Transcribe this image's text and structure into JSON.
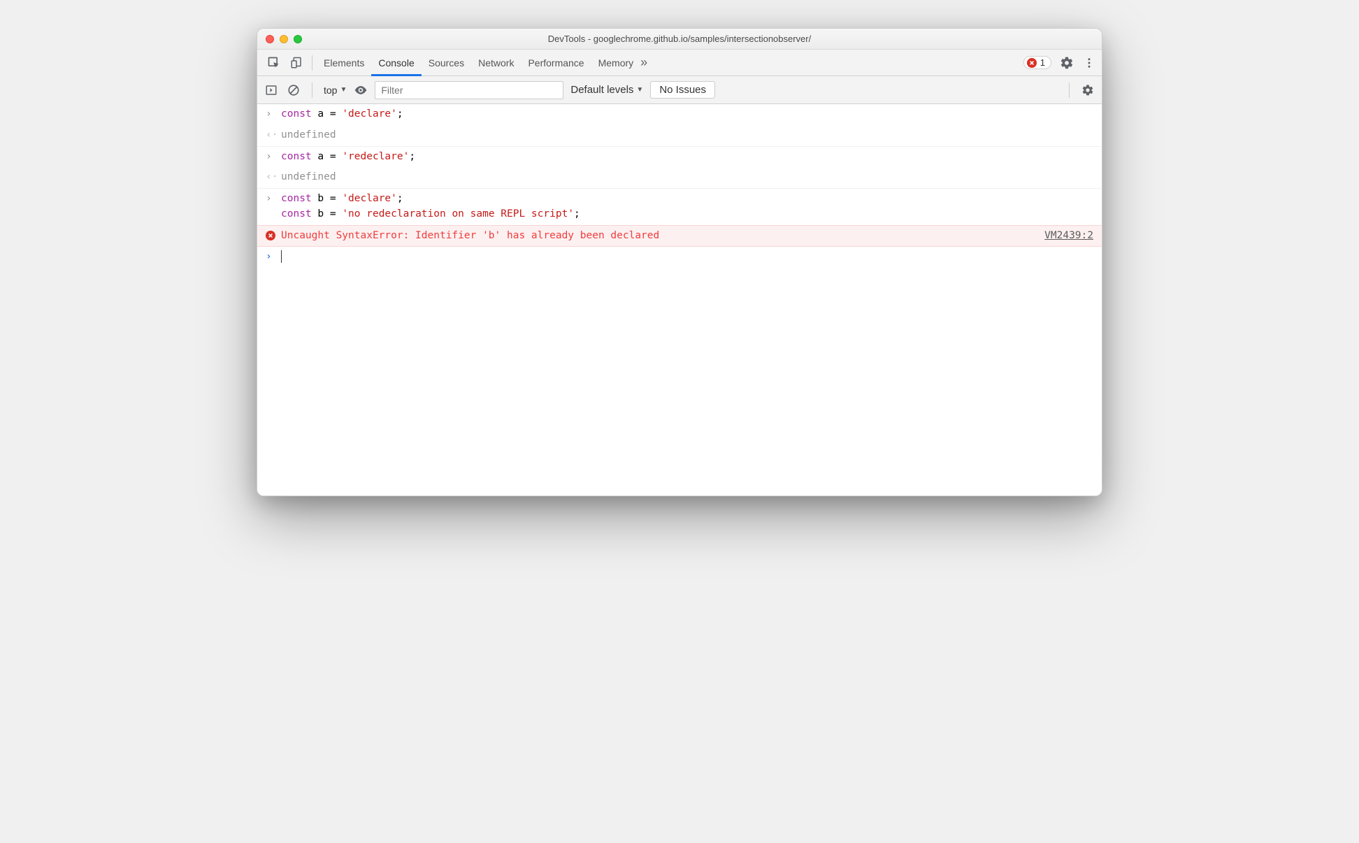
{
  "window": {
    "title": "DevTools - googlechrome.github.io/samples/intersectionobserver/"
  },
  "tabs": {
    "elements": "Elements",
    "console": "Console",
    "sources": "Sources",
    "network": "Network",
    "performance": "Performance",
    "memory": "Memory"
  },
  "error_badge": {
    "count": "1"
  },
  "toolbar": {
    "context": "top",
    "filter_placeholder": "Filter",
    "levels": "Default levels",
    "issues": "No Issues"
  },
  "console": {
    "entries": [
      {
        "type": "input",
        "tokens": [
          {
            "t": "kw",
            "v": "const"
          },
          {
            "t": "p",
            "v": " a "
          },
          {
            "t": "p",
            "v": "= "
          },
          {
            "t": "str",
            "v": "'declare'"
          },
          {
            "t": "p",
            "v": ";"
          }
        ]
      },
      {
        "type": "output",
        "text": "undefined"
      },
      {
        "type": "input",
        "tokens": [
          {
            "t": "kw",
            "v": "const"
          },
          {
            "t": "p",
            "v": " a "
          },
          {
            "t": "p",
            "v": "= "
          },
          {
            "t": "str",
            "v": "'redeclare'"
          },
          {
            "t": "p",
            "v": ";"
          }
        ]
      },
      {
        "type": "output",
        "text": "undefined"
      },
      {
        "type": "input-multi",
        "lines": [
          [
            {
              "t": "kw",
              "v": "const"
            },
            {
              "t": "p",
              "v": " b "
            },
            {
              "t": "p",
              "v": "= "
            },
            {
              "t": "str",
              "v": "'declare'"
            },
            {
              "t": "p",
              "v": ";"
            }
          ],
          [
            {
              "t": "kw",
              "v": "const"
            },
            {
              "t": "p",
              "v": " b "
            },
            {
              "t": "p",
              "v": "= "
            },
            {
              "t": "str",
              "v": "'no redeclaration on same REPL script'"
            },
            {
              "t": "p",
              "v": ";"
            }
          ]
        ]
      },
      {
        "type": "error",
        "text": "Uncaught SyntaxError: Identifier 'b' has already been declared",
        "source": "VM2439:2"
      }
    ]
  }
}
